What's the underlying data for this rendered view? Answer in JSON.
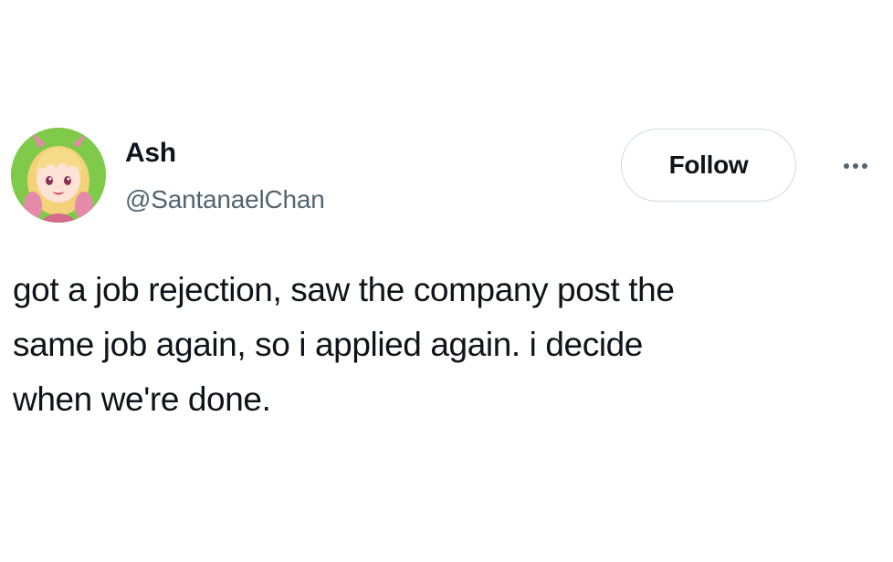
{
  "author": {
    "display_name": "Ash",
    "handle": "@SantanaelChan",
    "avatar_icon": "anime-avatar-icon"
  },
  "actions": {
    "follow_label": "Follow",
    "more_icon": "more-options-icon"
  },
  "tweet": {
    "lines": [
      "got a job rejection, saw the company post the",
      "same job again, so i applied again. i decide",
      "when we're done."
    ]
  },
  "colors": {
    "text_primary": "#0f1419",
    "text_secondary": "#536471",
    "button_border": "#cfd9de",
    "avatar_background": "#7fca4a"
  }
}
